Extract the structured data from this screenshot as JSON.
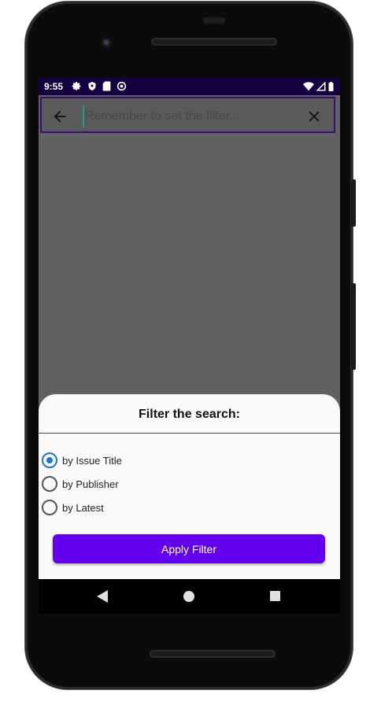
{
  "status_bar": {
    "time": "9:55",
    "left_icons": [
      "gear-icon",
      "shield-icon",
      "sd-card-icon",
      "at-sign-icon"
    ],
    "right_icons": [
      "wifi-icon",
      "signal-icon",
      "battery-icon"
    ]
  },
  "search": {
    "placeholder": "Remember to set the filter...",
    "value": ""
  },
  "sheet": {
    "title": "Filter the search:",
    "options": [
      {
        "label": "by Issue Title",
        "checked": true
      },
      {
        "label": "by Publisher",
        "checked": false
      },
      {
        "label": "by Latest",
        "checked": false
      }
    ],
    "apply_label": "Apply Filter"
  },
  "colors": {
    "status_bar": "#130040",
    "accent": "#6200ee",
    "radio_checked": "#1976d2",
    "scrim": "#616161"
  }
}
